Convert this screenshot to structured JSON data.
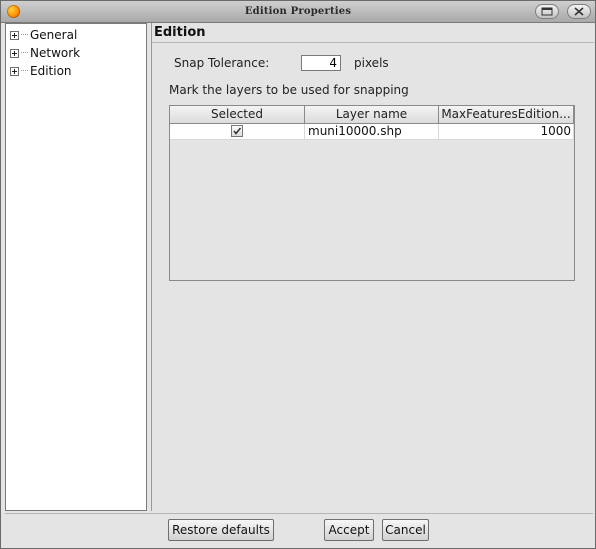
{
  "window": {
    "title": "Edition Properties"
  },
  "tree": {
    "items": [
      {
        "label": "General"
      },
      {
        "label": "Network"
      },
      {
        "label": "Edition"
      }
    ]
  },
  "panel": {
    "title": "Edition",
    "snap_label": "Snap Tolerance:",
    "snap_value": "4",
    "snap_unit": "pixels",
    "mark_label": "Mark the layers to be used for snapping"
  },
  "table": {
    "columns": [
      "Selected",
      "Layer name",
      "MaxFeaturesEdition..."
    ],
    "rows": [
      {
        "selected": true,
        "layer": "muni10000.shp",
        "max": "1000"
      }
    ]
  },
  "buttons": {
    "restore": "Restore defaults",
    "accept": "Accept",
    "cancel": "Cancel"
  },
  "icons": {
    "app": "app-logo-icon",
    "maximize": "maximize-icon",
    "close": "close-icon",
    "expand": "plus-expander-icon",
    "check": "checkmark-icon"
  },
  "colors": {
    "window_bg": "#e4e4e4",
    "titlebar": "#bdbdbd",
    "tree_bg": "#ffffff"
  }
}
